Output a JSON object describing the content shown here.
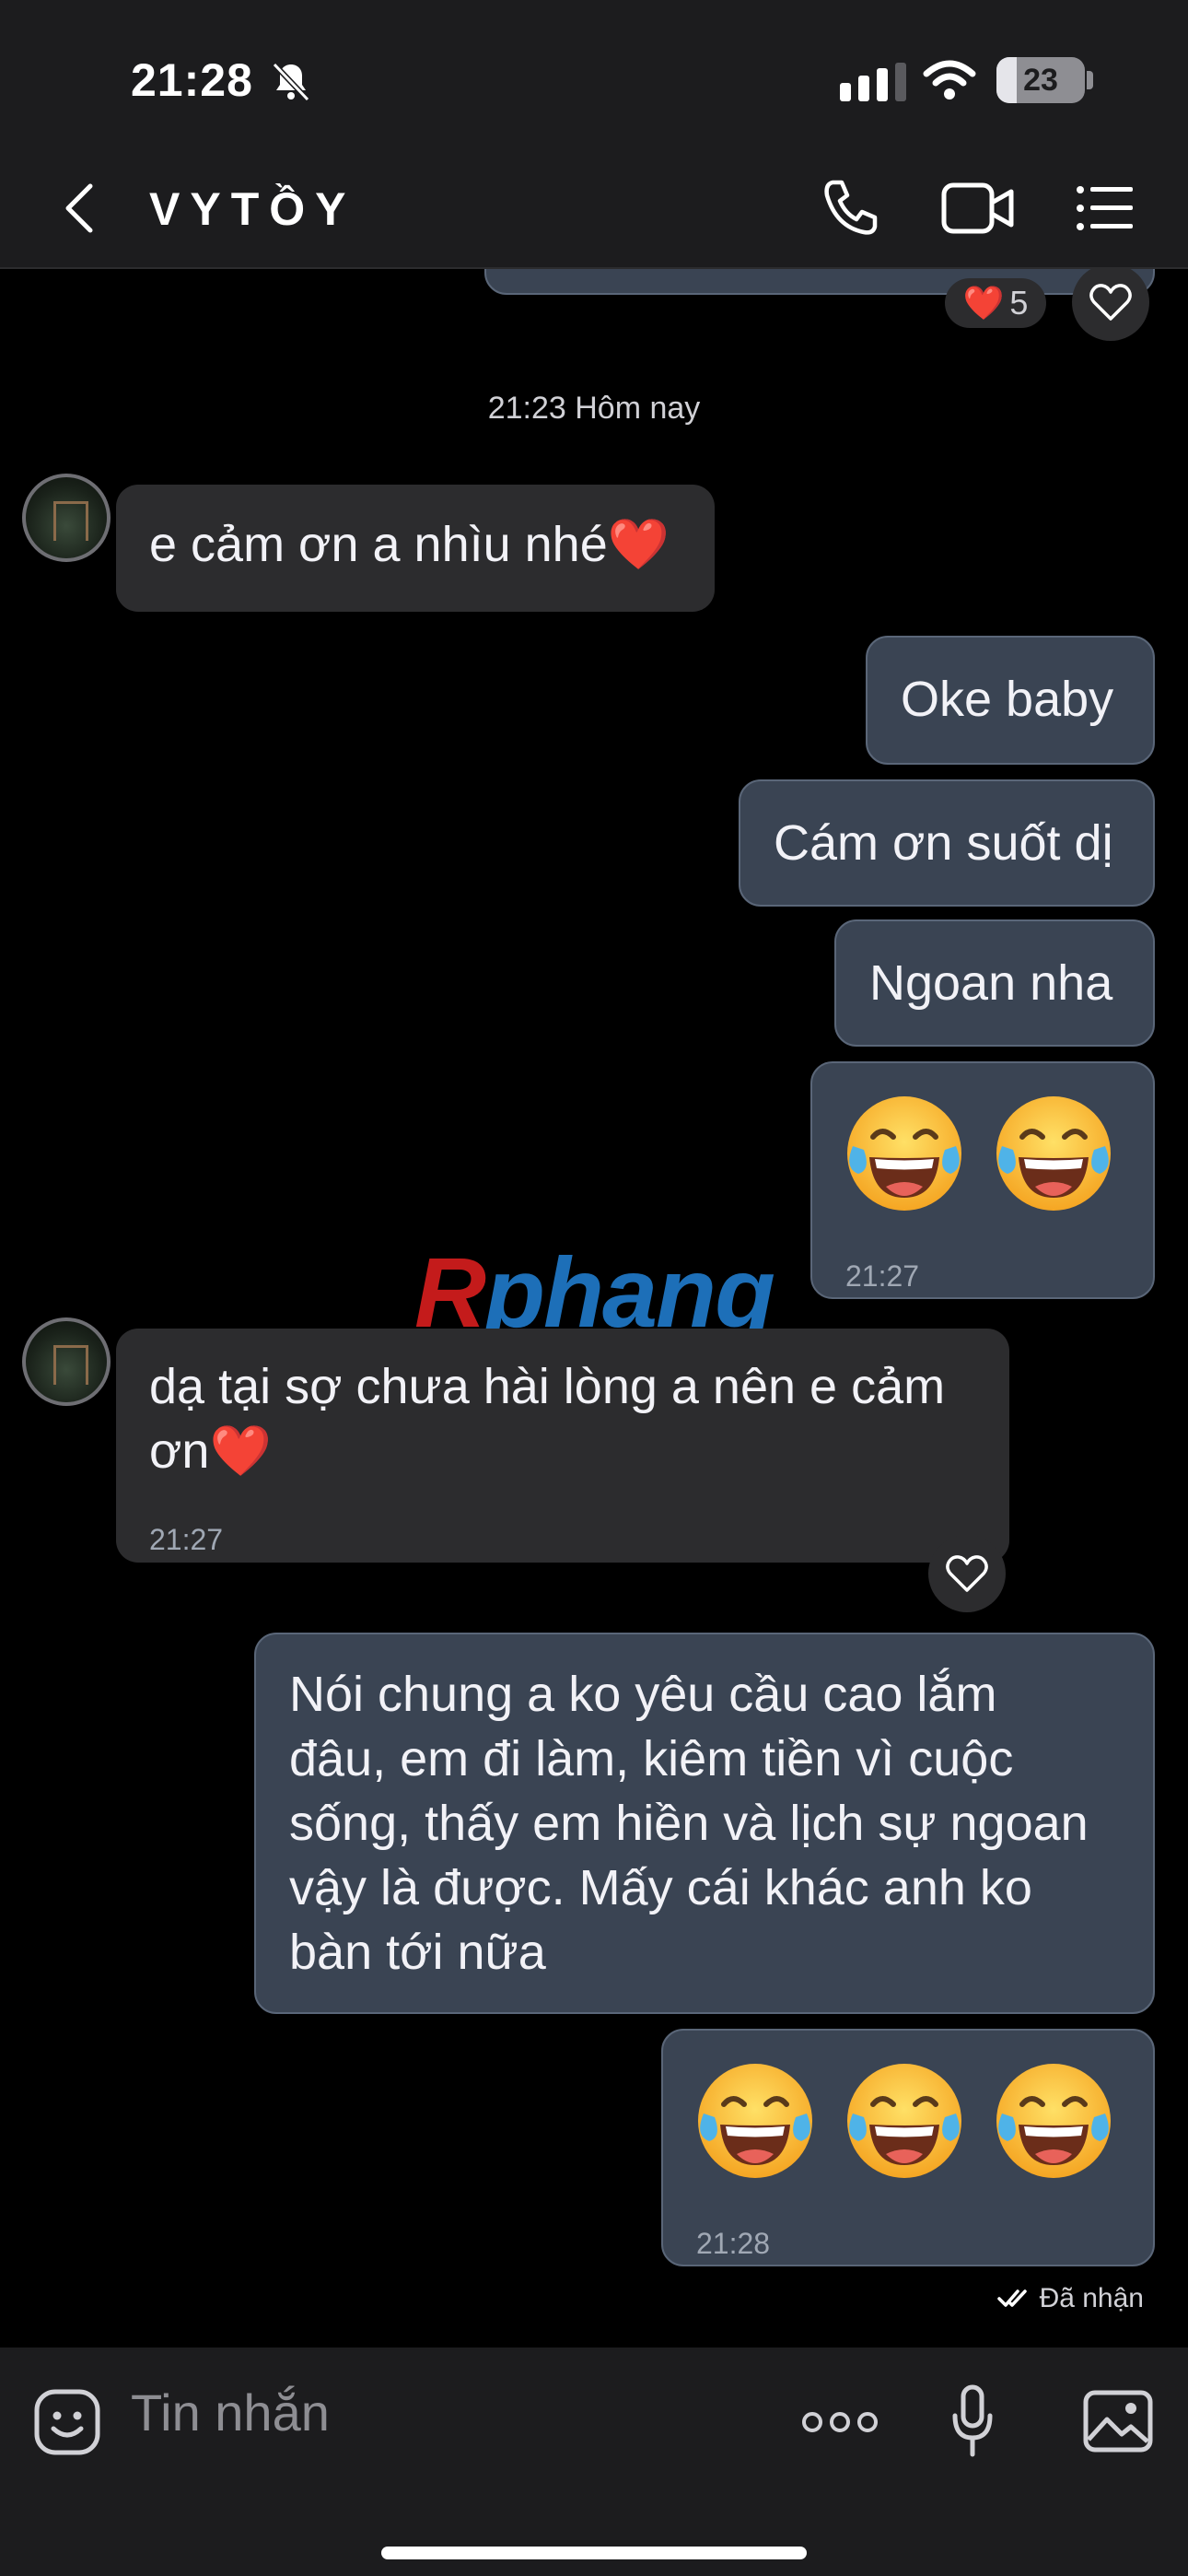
{
  "status_bar": {
    "time": "21:28",
    "battery": "23",
    "battery_level": 0.23
  },
  "header": {
    "contact_name": "VYTỒY"
  },
  "reaction": {
    "emoji": "❤️",
    "count": "5"
  },
  "date_divider": "21:23 Hôm nay",
  "messages": [
    {
      "text": "e cảm ơn a nhìu nhé❤️"
    },
    {
      "text": "Oke baby"
    },
    {
      "text": "Cám ơn suốt dị"
    },
    {
      "text": "Ngoan nha"
    },
    {
      "time": "21:27"
    },
    {
      "line1": "dạ tại sợ chưa hài lòng a nên e cảm",
      "line2": "ơn❤️",
      "time": "21:27"
    },
    {
      "lines": [
        "Nói chung a ko yêu cầu cao lắm",
        "đâu, em đi làm, kiêm tiền vì cuộc",
        "sống, thấy em hiền và lịch sự ngoan",
        "vậy là được. Mấy cái khác anh ko",
        "bàn tới nữa"
      ]
    },
    {
      "time": "21:28"
    }
  ],
  "delivery_status": "Đã nhận",
  "watermark": {
    "r": "R",
    "rest": "phang"
  },
  "composer": {
    "placeholder": "Tin nhắn"
  },
  "colors": {
    "incoming_bubble": "#2c2c2e",
    "outgoing_bubble": "#3a4453",
    "background": "#000000"
  }
}
